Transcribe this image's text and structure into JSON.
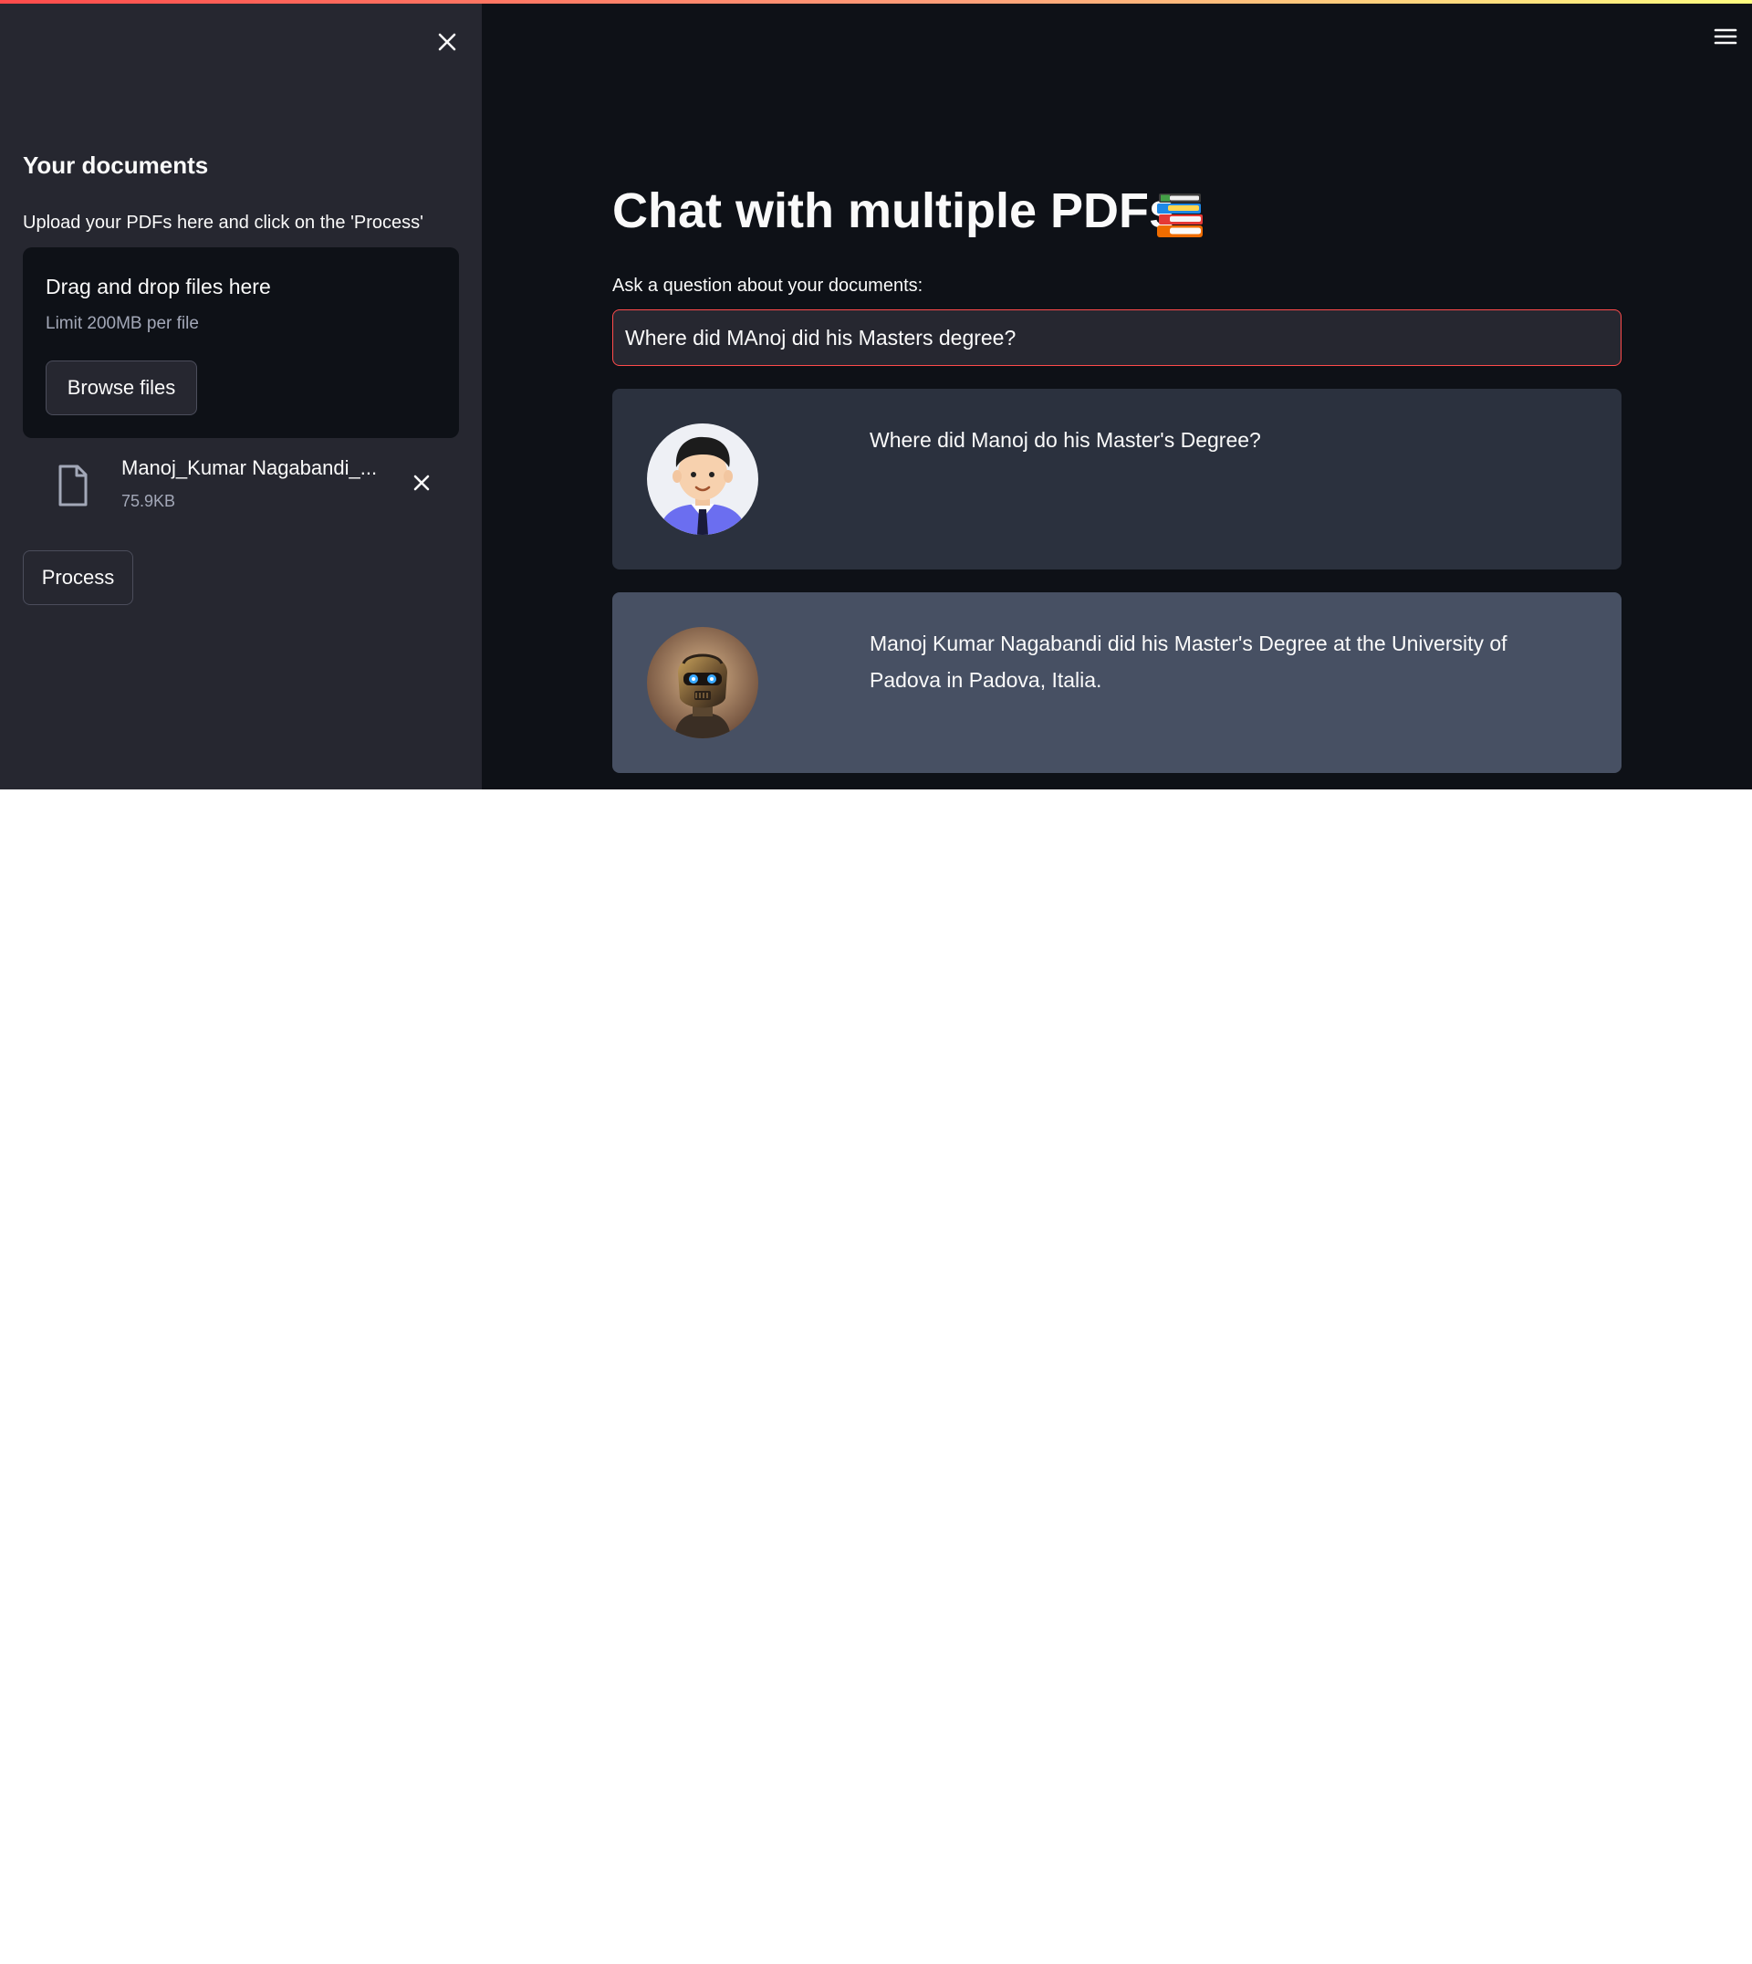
{
  "sidebar": {
    "heading": "Your documents",
    "instruction": "Upload your PDFs here and click on the 'Process'",
    "uploader": {
      "drag_text": "Drag and drop files here",
      "limit_text": "Limit 200MB per file",
      "browse_label": "Browse files"
    },
    "file": {
      "name": "Manoj_Kumar Nagabandi_...",
      "size": "75.9KB"
    },
    "process_label": "Process"
  },
  "main": {
    "title": "Chat with multiple PDFs",
    "question_label": "Ask a question about your documents:",
    "question_value": "Where did MAnoj did his Masters degree?",
    "messages": [
      {
        "role": "user",
        "text": "Where did Manoj do his Master's Degree?"
      },
      {
        "role": "bot",
        "text": "Manoj Kumar Nagabandi did his Master's Degree at the University of Padova in Padova, Italia."
      }
    ]
  },
  "colors": {
    "app_background": "#0e1117",
    "sidebar_background": "#262730",
    "user_message_background": "#2b313e",
    "bot_message_background": "#475063",
    "input_focus_border": "#ff4b4b"
  },
  "icons": {
    "sidebar_close": "close-icon",
    "main_menu": "hamburger-menu-icon",
    "file": "file-icon",
    "file_remove": "close-icon",
    "title_emoji": "books-icon"
  }
}
